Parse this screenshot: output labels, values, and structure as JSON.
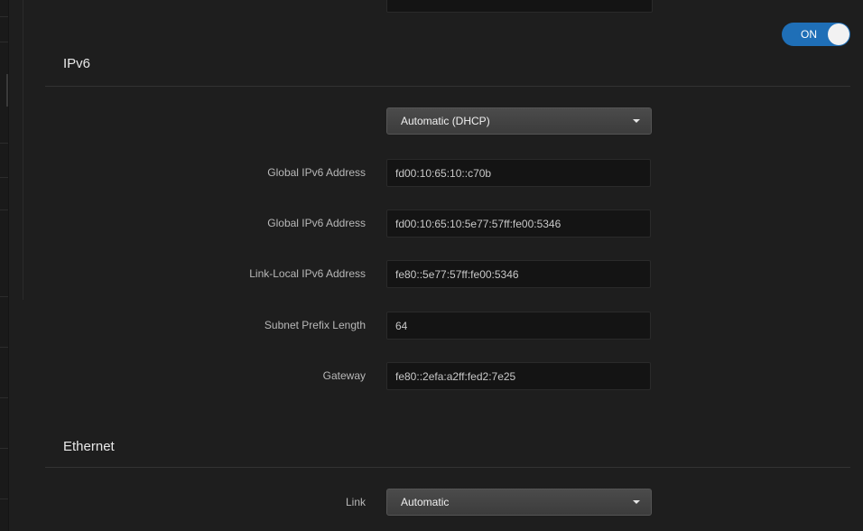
{
  "toggle": {
    "label": "ON"
  },
  "ipv6": {
    "title": "IPv6",
    "mode": {
      "selected": "Automatic (DHCP)"
    },
    "fields": [
      {
        "label": "Global IPv6 Address",
        "value": "fd00:10:65:10::c70b"
      },
      {
        "label": "Global IPv6 Address",
        "value": "fd00:10:65:10:5e77:57ff:fe00:5346"
      },
      {
        "label": "Link-Local IPv6 Address",
        "value": "fe80::5e77:57ff:fe00:5346"
      },
      {
        "label": "Subnet Prefix Length",
        "value": "64"
      },
      {
        "label": "Gateway",
        "value": "fe80::2efa:a2ff:fed2:7e25"
      }
    ]
  },
  "ethernet": {
    "title": "Ethernet",
    "link": {
      "label": "Link",
      "selected": "Automatic"
    }
  }
}
